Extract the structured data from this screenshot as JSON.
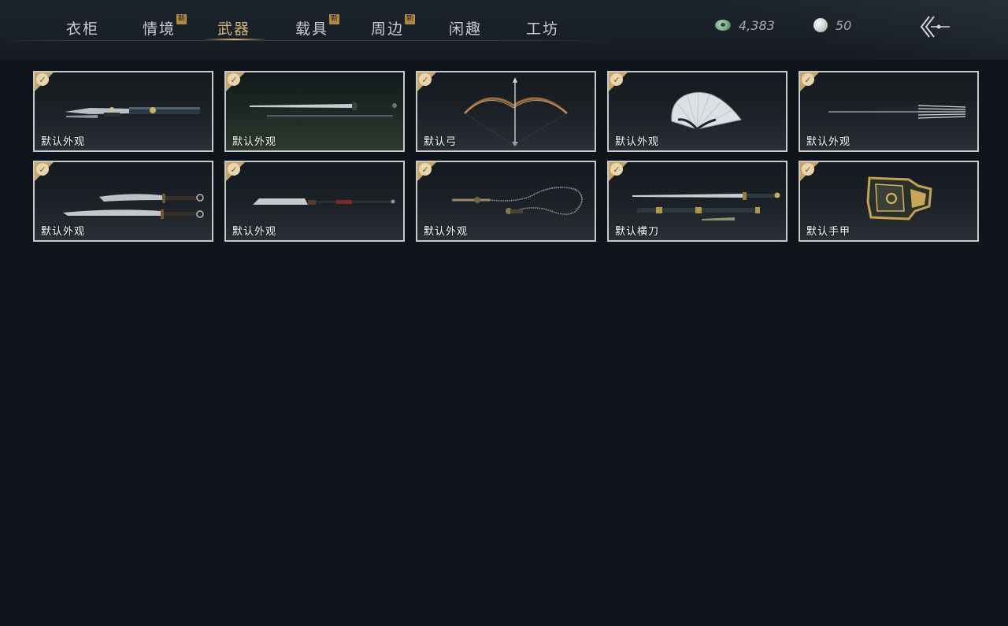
{
  "tabs": [
    {
      "label": "衣柜",
      "new": false
    },
    {
      "label": "情境",
      "new": true
    },
    {
      "label": "武器",
      "new": false,
      "active": true
    },
    {
      "label": "载具",
      "new": true
    },
    {
      "label": "周边",
      "new": true
    },
    {
      "label": "闲趣",
      "new": false
    },
    {
      "label": "工坊",
      "new": false
    }
  ],
  "new_badge": "新",
  "currencies": {
    "jade_coin": {
      "icon": "jade-coin-icon",
      "value": "4,383"
    },
    "pearl": {
      "icon": "pearl-icon",
      "value": "50"
    }
  },
  "back_icon": "back-arrow-icon",
  "items": [
    {
      "label": "默认外观",
      "icon": "twin-daggers-icon",
      "owned": true
    },
    {
      "label": "默认外观",
      "icon": "long-sword-icon",
      "owned": true
    },
    {
      "label": "默认弓",
      "icon": "bow-icon",
      "owned": true
    },
    {
      "label": "默认外观",
      "icon": "folding-fan-icon",
      "owned": true
    },
    {
      "label": "默认外观",
      "icon": "umbrella-icon",
      "owned": true
    },
    {
      "label": "默认外观",
      "icon": "dual-blades-icon",
      "owned": true
    },
    {
      "label": "默认外观",
      "icon": "glaive-icon",
      "owned": true
    },
    {
      "label": "默认外观",
      "icon": "rope-dart-icon",
      "owned": true
    },
    {
      "label": "默认横刀",
      "icon": "hengdao-icon",
      "owned": true
    },
    {
      "label": "默认手甲",
      "icon": "gauntlet-icon",
      "owned": true
    }
  ],
  "colors": {
    "accent_gold": "#d6b57a",
    "owned_corner": "#c8a363",
    "background": "#0f141a"
  }
}
